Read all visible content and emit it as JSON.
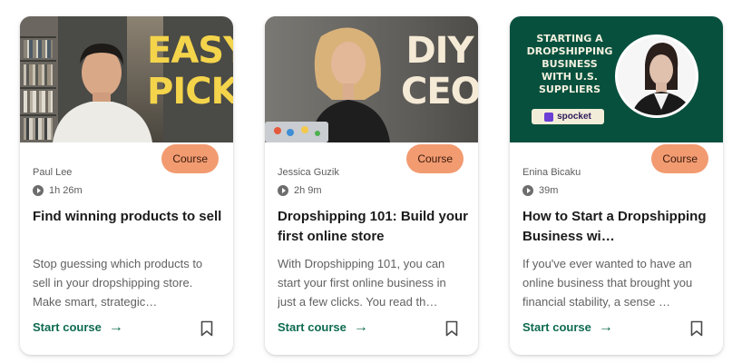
{
  "cards": [
    {
      "thumbnail_text": [
        "EASY",
        "PICK"
      ],
      "badge": "Course",
      "author": "Paul Lee",
      "duration": "1h 26m",
      "title": "Find winning products to sell",
      "description": "Stop guessing which products to sell in your dropshipping store. Make smart, strategic…",
      "cta": "Start course"
    },
    {
      "thumbnail_text": [
        "DIY",
        "CEO"
      ],
      "badge": "Course",
      "author": "Jessica Guzik",
      "duration": "2h 9m",
      "title": "Dropshipping 101: Build your first online store",
      "description": "With Dropshipping 101, you can start your first online business in just a few clicks. You read th…",
      "cta": "Start course"
    },
    {
      "thumbnail_text": [
        "STARTING A",
        "DROPSHIPPING",
        "BUSINESS",
        "WITH U.S.",
        "SUPPLIERS"
      ],
      "thumbnail_logo": "spocket",
      "badge": "Course",
      "author": "Enina Bicaku",
      "duration": "39m",
      "title": "How to Start a Dropshipping Business wi…",
      "description": "If you've ever wanted to have an online business that brought you financial stability, a sense …",
      "cta": "Start course"
    }
  ],
  "colors": {
    "accent": "#0f6b50",
    "badge": "#f29b71",
    "thumb3_bg": "#08503e",
    "headline_yellow": "#f4d44b"
  }
}
